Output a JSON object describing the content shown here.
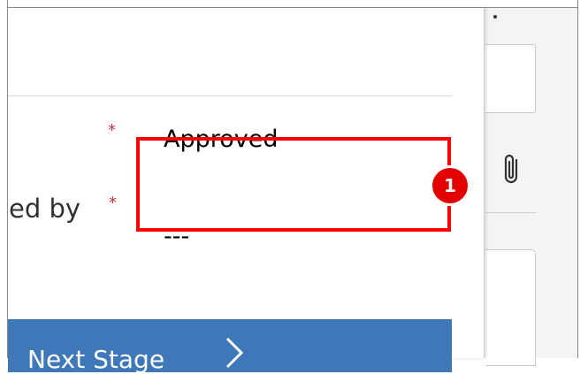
{
  "form": {
    "fields": [
      {
        "label": "",
        "required_marker": "*",
        "value": "Approved"
      },
      {
        "label": "ed by",
        "required_marker": "*",
        "value": "---"
      }
    ]
  },
  "footer": {
    "next_stage_label": "Next Stage",
    "next_stage_icon": "chevron-right-icon"
  },
  "annotation": {
    "step_number": "1",
    "highlight_color": "#ff0000"
  },
  "side_panel": {
    "attach_icon": "paperclip-icon"
  },
  "colors": {
    "accent": "#3f78b8",
    "required": "#d13438",
    "badge": "#e30000"
  }
}
